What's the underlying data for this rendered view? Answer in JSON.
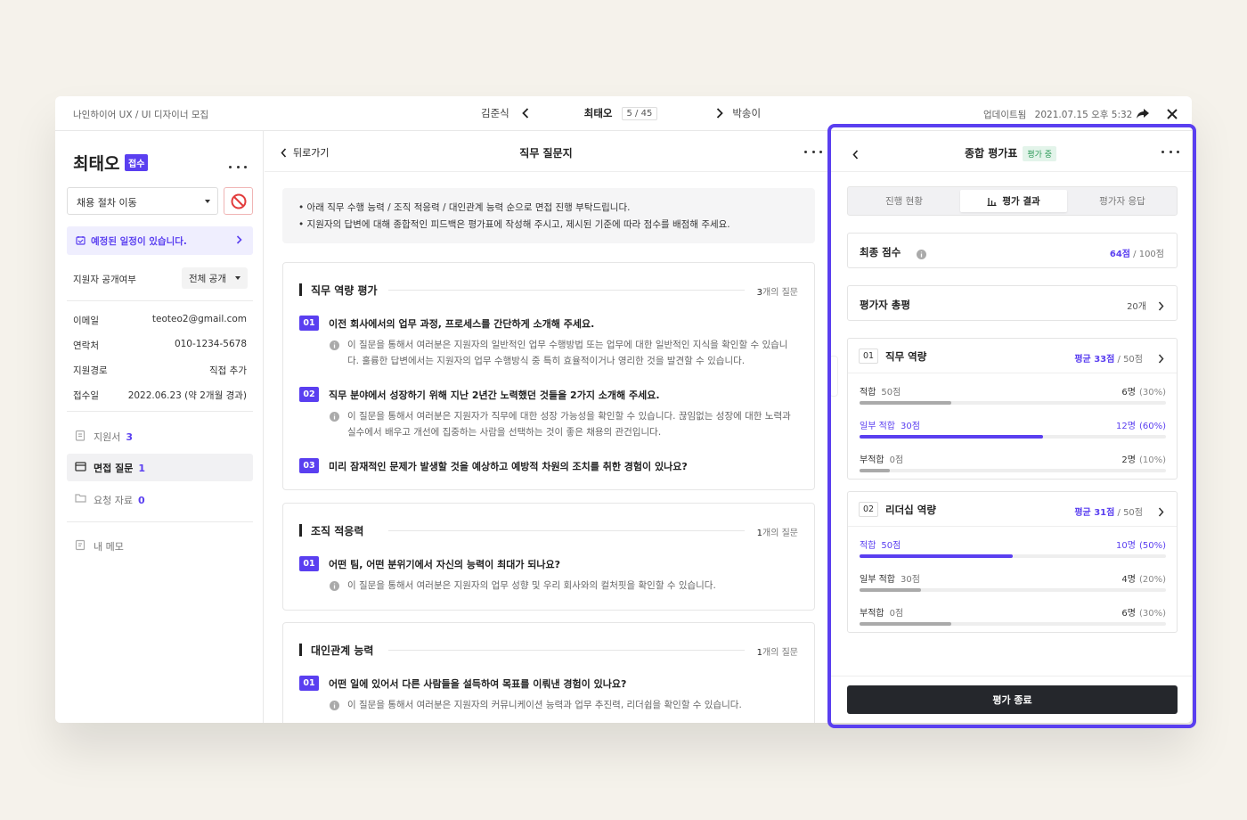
{
  "topbar": {
    "breadcrumb": "나인하이어 UX / UI 디자이너 모집",
    "prev_name": "김준식",
    "current_name": "최태오",
    "counter": "5 / 45",
    "next_name": "박송이",
    "updated_label": "업데이트됨",
    "updated_time": "2021.07.15 오후 5:32"
  },
  "applicant": {
    "name": "최태오",
    "status_badge": "접수",
    "stage_select": "채용 절차 이동",
    "schedule_notice": "예정된 일정이 있습니다.",
    "visibility_label": "지원자 공개여부",
    "visibility_value": "전체 공개",
    "info": [
      {
        "key": "이메일",
        "value": "teoteo2@gmail.com"
      },
      {
        "key": "연락처",
        "value": "010-1234-5678"
      },
      {
        "key": "지원경로",
        "value": "직접 추가"
      },
      {
        "key": "접수일",
        "value": "2022.06.23 (약 2개월 경과)"
      }
    ],
    "menu": [
      {
        "label": "지원서",
        "count": "3"
      },
      {
        "label": "면접 질문",
        "count": "1"
      },
      {
        "label": "요청 자료",
        "count": "0"
      },
      {
        "label": "내 메모",
        "count": ""
      }
    ]
  },
  "questionnaire": {
    "back_label": "뒤로가기",
    "title": "직무 질문지",
    "notices": [
      "아래 직무 수행 능력 / 조직 적응력 /  대인관계 능력 순으로  면접 진행 부탁드립니다.",
      "지원자의 답변에 대해 종합적인 피드백은 평가표에 작성해 주시고, 제시된 기준에 따라 점수를 배점해 주세요."
    ],
    "sections": [
      {
        "title": "직무 역량 평가",
        "count_num": "3",
        "count_suffix": "개의 질문",
        "questions": [
          {
            "num": "01",
            "text": "이전 회사에서의 업무 과정, 프로세스를 간단하게 소개해 주세요.",
            "desc": "이 질문을 통해서 여러분은 지원자의 일반적인 업무 수행방법 또는 업무에 대한 일반적인 지식을 확인할 수 있습니다. 훌륭한 답변에서는 지원자의 업무 수행방식 중 특히 효율적이거나 영리한 것을 발견할 수 있습니다."
          },
          {
            "num": "02",
            "text": "직무 분야에서 성장하기 위해 지난 2년간 노력했던 것들을 2가지 소개해 주세요.",
            "desc": "이 질문을 통해서 여러분은 지원자가 직무에 대한 성장 가능성을 확인할 수 있습니다. 끊임없는 성장에 대한 노력과 실수에서 배우고 개선에 집중하는 사람을 선택하는 것이 좋은 채용의 관건입니다."
          },
          {
            "num": "03",
            "text": "미리 잠재적인 문제가 발생할 것을 예상하고 예방적 차원의 조치를 취한 경험이 있나요?",
            "desc": ""
          }
        ]
      },
      {
        "title": "조직 적응력",
        "count_num": "1",
        "count_suffix": "개의 질문",
        "questions": [
          {
            "num": "01",
            "text": "어떤 팀, 어떤 분위기에서 자신의 능력이 최대가 되나요?",
            "desc": "이 질문을 통해서 여러분은 지원자의 업무 성향 및 우리 회사와의 컬처핏을 확인할 수 있습니다."
          }
        ]
      },
      {
        "title": "대인관계 능력",
        "count_num": "1",
        "count_suffix": "개의 질문",
        "questions": [
          {
            "num": "01",
            "text": "어떤 일에 있어서 다른 사람들을 설득하여 목표를 이뤄낸 경험이 있나요?",
            "desc": "이 질문을 통해서 여러분은 지원자의 커뮤니케이션 능력과 업무 추진력, 리더쉽을 확인할 수 있습니다."
          }
        ]
      }
    ]
  },
  "evaluation": {
    "title": "종합 평가표",
    "status": "평가 중",
    "tabs": [
      "진행 현황",
      "평가 결과",
      "평가자 응답"
    ],
    "final_score_label": "최종 점수",
    "final_score_value": "64점",
    "final_score_total": " / 100점",
    "reviews_label": "평가자 총평",
    "reviews_count": "20개",
    "competencies": [
      {
        "num": "01",
        "title": "직무 역량",
        "avg_value": "평균 33점",
        "avg_total": " / 50점",
        "rows": [
          {
            "label": "적합",
            "points": "50점",
            "count": "6명",
            "pct_text": "(30%)",
            "fraction": 0.3,
            "highlight": false
          },
          {
            "label": "일부 적합",
            "points": "30점",
            "count": "12명",
            "pct_text": "(60%)",
            "fraction": 0.6,
            "highlight": true
          },
          {
            "label": "부적합",
            "points": "0점",
            "count": "2명",
            "pct_text": "(10%)",
            "fraction": 0.1,
            "highlight": false
          }
        ]
      },
      {
        "num": "02",
        "title": "리더십 역량",
        "avg_value": "평균 31점",
        "avg_total": " / 50점",
        "rows": [
          {
            "label": "적합",
            "points": "50점",
            "count": "10명",
            "pct_text": "(50%)",
            "fraction": 0.5,
            "highlight": true
          },
          {
            "label": "일부 적합",
            "points": "30점",
            "count": "4명",
            "pct_text": "(20%)",
            "fraction": 0.2,
            "highlight": false
          },
          {
            "label": "부적합",
            "points": "0점",
            "count": "6명",
            "pct_text": "(30%)",
            "fraction": 0.3,
            "highlight": false
          }
        ]
      }
    ],
    "end_button": "평가 종료"
  },
  "colors": {
    "accent": "#5a3ff0",
    "frame": "#5a3ff0",
    "badge_green": "#2f9a5a"
  }
}
